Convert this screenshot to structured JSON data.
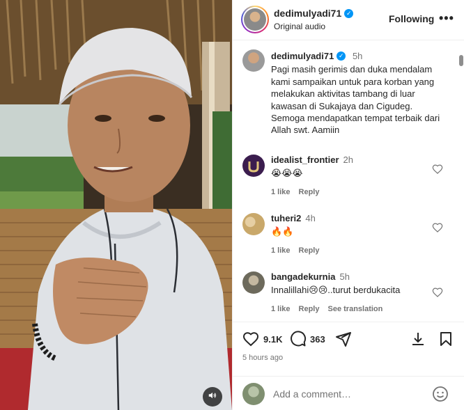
{
  "media": {
    "audio_icon": "volume-icon"
  },
  "header": {
    "username": "dedimulyadi71",
    "subtitle": "Original audio",
    "follow_label": "Following",
    "more_label": "•••"
  },
  "caption": {
    "username": "dedimulyadi71",
    "time": "5h",
    "text": "Pagi masih gerimis dan duka mendalam kami sampaikan untuk para korban yang melakukan aktivitas tambang di luar kawasan di Sukajaya dan Cigudeg. Semoga mendapatkan tempat terbaik dari Allah swt. Aamiin"
  },
  "comments": [
    {
      "username": "idealist_frontier",
      "time": "2h",
      "text": "😭😭😭",
      "likes": "1 like",
      "reply": "Reply",
      "extra": "",
      "avatar_color": "#3b1d4e"
    },
    {
      "username": "tuheri2",
      "time": "4h",
      "text": "🔥🔥",
      "likes": "1 like",
      "reply": "Reply",
      "extra": "",
      "avatar_color": "#c9a86a"
    },
    {
      "username": "bangadekurnia",
      "time": "5h",
      "text": "Innalillahi😢😢..turut berdukacita",
      "likes": "1 like",
      "reply": "Reply",
      "extra": "See translation",
      "avatar_color": "#8c8c7a"
    }
  ],
  "actions": {
    "likes": "9.1K",
    "comments": "363",
    "posted": "5 hours ago"
  },
  "add_comment": {
    "placeholder": "Add a comment…"
  },
  "colors": {
    "verified": "#0095f6",
    "muted_text": "#737373",
    "primary_text": "#262626"
  }
}
